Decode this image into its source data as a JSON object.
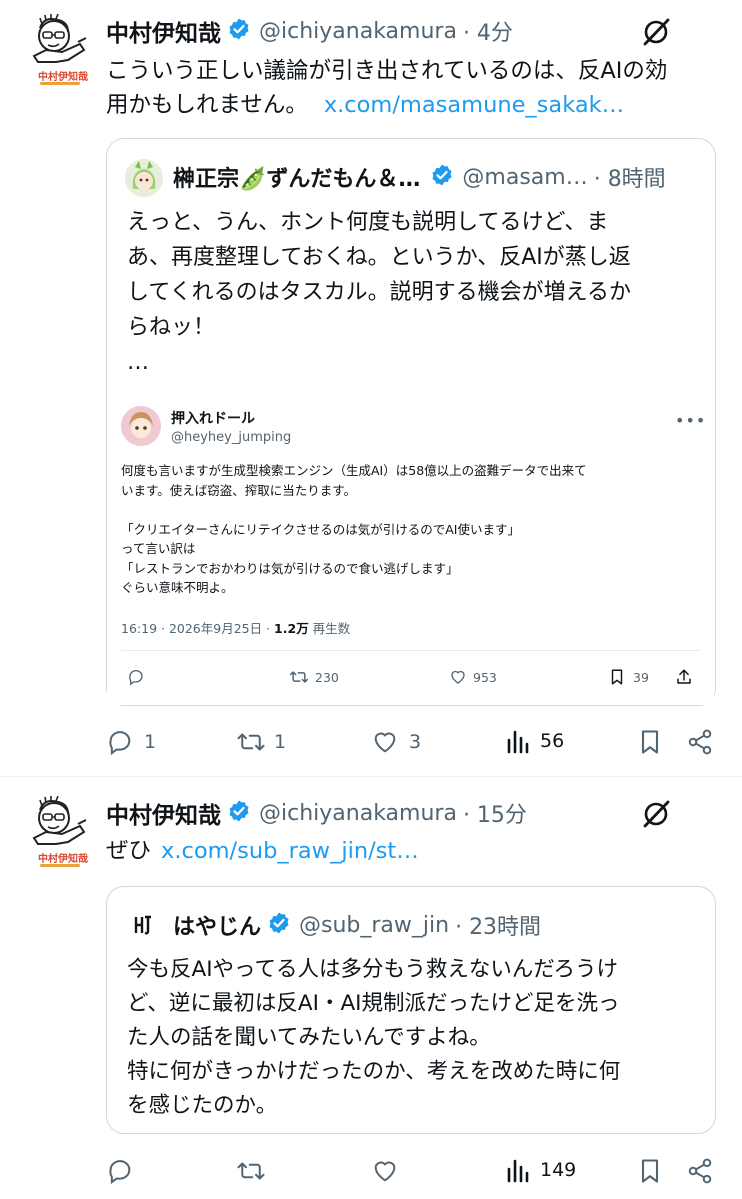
{
  "post1": {
    "author_name": "中村伊知哉",
    "handle": "@ichiyanakamura",
    "time": "· 4分",
    "text": "こういう正しい議論が引き出されているのは、反AIの効",
    "text2": "用かもしれません。",
    "link": "x.com/masamune_sakak…",
    "quote": {
      "author_name": "榊正宗🫛ずんだもん＆…",
      "handle": "@masam…",
      "time": "· 8時間",
      "lines": [
        "えっと、うん、ホント何度も説明してるけど、ま",
        "あ、再度整理しておくね。というか、反AIが蒸し返",
        "してくれるのはタスカル。説明する機会が増えるか",
        "らねッ！",
        "…"
      ],
      "embedded": {
        "author_name": "押入れドール",
        "handle": "@heyhey_jumping",
        "lines": [
          "何度も言いますが生成型検索エンジン（生成AI）は58億以上の盗難データで出来て",
          "います。使えば窃盗、搾取に当たります。",
          "",
          "「クリエイターさんにリテイクさせるのは気が引けるのでAI使います」",
          "って言い訳は",
          "「レストランでおかわりは気が引けるので食い逃げします」",
          "ぐらい意味不明よ。"
        ],
        "timestamp": "16:19 · 2026年9月25日 · ",
        "views": "1.2万",
        "views_label": " 再生数",
        "retweets": "230",
        "likes": "953",
        "bookmarks": "39"
      }
    },
    "replies": "1",
    "reposts": "1",
    "likes": "3",
    "views": "56"
  },
  "post2": {
    "author_name": "中村伊知哉",
    "handle": "@ichiyanakamura",
    "time": "· 15分",
    "text": "ぜひ",
    "link": "x.com/sub_raw_jin/st…",
    "quote": {
      "author_name": "はやじん",
      "handle": "@sub_raw_jin",
      "time": "· 23時間",
      "lines": [
        "今も反AIやってる人は多分もう救えないんだろうけ",
        "ど、逆に最初は反AI・AI規制派だったけど足を洗っ",
        "た人の話を聞いてみたいんですよね。",
        "特に何がきっかけだったのか、考えを改めた時に何",
        "を感じたのか。"
      ]
    },
    "views": "149"
  },
  "avatar_label": "中村伊知哉",
  "colors": {
    "verified": "#1d9bf0",
    "link": "#1d9bf0",
    "muted": "#536471",
    "border": "#cfd9de"
  }
}
